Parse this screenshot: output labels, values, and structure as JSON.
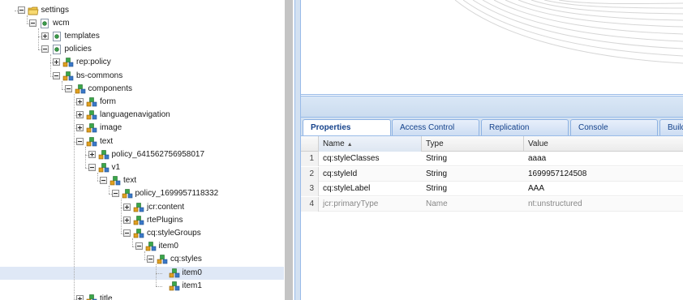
{
  "tree": {
    "partial_top_label": "",
    "nodes": [
      {
        "key": "settings",
        "label": "settings",
        "depth": 1,
        "state": "expanded",
        "icon": "folder-icon"
      },
      {
        "key": "wcm",
        "label": "wcm",
        "depth": 2,
        "state": "expanded",
        "icon": "page-icon"
      },
      {
        "key": "templates",
        "label": "templates",
        "depth": 3,
        "state": "collapsed",
        "icon": "page-icon"
      },
      {
        "key": "policies",
        "label": "policies",
        "depth": 3,
        "state": "expanded",
        "icon": "page-icon"
      },
      {
        "key": "rep-policy",
        "label": "rep:policy",
        "depth": 4,
        "state": "collapsed",
        "icon": "node-icon"
      },
      {
        "key": "bs-commons",
        "label": "bs-commons",
        "depth": 4,
        "state": "expanded",
        "icon": "node-icon"
      },
      {
        "key": "components",
        "label": "components",
        "depth": 5,
        "state": "expanded",
        "icon": "node-icon"
      },
      {
        "key": "form",
        "label": "form",
        "depth": 6,
        "state": "collapsed",
        "icon": "node-icon"
      },
      {
        "key": "languagenavigation",
        "label": "languagenavigation",
        "depth": 6,
        "state": "collapsed",
        "icon": "node-icon"
      },
      {
        "key": "image",
        "label": "image",
        "depth": 6,
        "state": "collapsed",
        "icon": "node-icon"
      },
      {
        "key": "text",
        "label": "text",
        "depth": 6,
        "state": "expanded",
        "icon": "node-icon"
      },
      {
        "key": "policy-641562756958017",
        "label": "policy_641562756958017",
        "depth": 7,
        "state": "collapsed",
        "icon": "node-icon"
      },
      {
        "key": "v1",
        "label": "v1",
        "depth": 7,
        "state": "expanded",
        "icon": "node-icon"
      },
      {
        "key": "text-2",
        "label": "text",
        "depth": 8,
        "state": "expanded",
        "icon": "node-icon"
      },
      {
        "key": "policy-1699957118332",
        "label": "policy_1699957118332",
        "depth": 9,
        "state": "expanded",
        "icon": "node-icon"
      },
      {
        "key": "jcr-content",
        "label": "jcr:content",
        "depth": 10,
        "state": "collapsed",
        "icon": "node-icon"
      },
      {
        "key": "rteplugins",
        "label": "rtePlugins",
        "depth": 10,
        "state": "collapsed",
        "icon": "node-icon"
      },
      {
        "key": "cq-stylegroups",
        "label": "cq:styleGroups",
        "depth": 10,
        "state": "expanded",
        "icon": "node-icon"
      },
      {
        "key": "item0",
        "label": "item0",
        "depth": 11,
        "state": "expanded",
        "icon": "node-icon"
      },
      {
        "key": "cq-styles",
        "label": "cq:styles",
        "depth": 12,
        "state": "expanded",
        "icon": "node-icon"
      },
      {
        "key": "item0-leaf",
        "label": "item0",
        "depth": 13,
        "state": "leaf",
        "icon": "node-icon",
        "selected": true
      },
      {
        "key": "item1-leaf",
        "label": "item1",
        "depth": 13,
        "state": "leaf",
        "icon": "node-icon"
      },
      {
        "key": "title",
        "label": "title",
        "depth": 6,
        "state": "collapsed",
        "icon": "node-icon"
      }
    ]
  },
  "tabs": [
    {
      "label": "Properties",
      "active": true
    },
    {
      "label": "Access Control",
      "active": false
    },
    {
      "label": "Replication",
      "active": false
    },
    {
      "label": "Console",
      "active": false
    },
    {
      "label": "Build",
      "active": false
    }
  ],
  "grid": {
    "columns": {
      "name": "Name",
      "type": "Type",
      "value": "Value"
    },
    "sort_indicator": "▲",
    "rows": [
      {
        "num": "1",
        "name": "cq:styleClasses",
        "type": "String",
        "value": "aaaa",
        "dim": false
      },
      {
        "num": "2",
        "name": "cq:styleId",
        "type": "String",
        "value": "1699957124508",
        "dim": false
      },
      {
        "num": "3",
        "name": "cq:styleLabel",
        "type": "String",
        "value": "AAA",
        "dim": false
      },
      {
        "num": "4",
        "name": "jcr:primaryType",
        "type": "Name",
        "value": "nt:unstructured",
        "dim": true
      }
    ]
  },
  "colors": {
    "selection": "#dfe8f6",
    "panel_border": "#99bbe8",
    "tab_text": "#15428b"
  }
}
